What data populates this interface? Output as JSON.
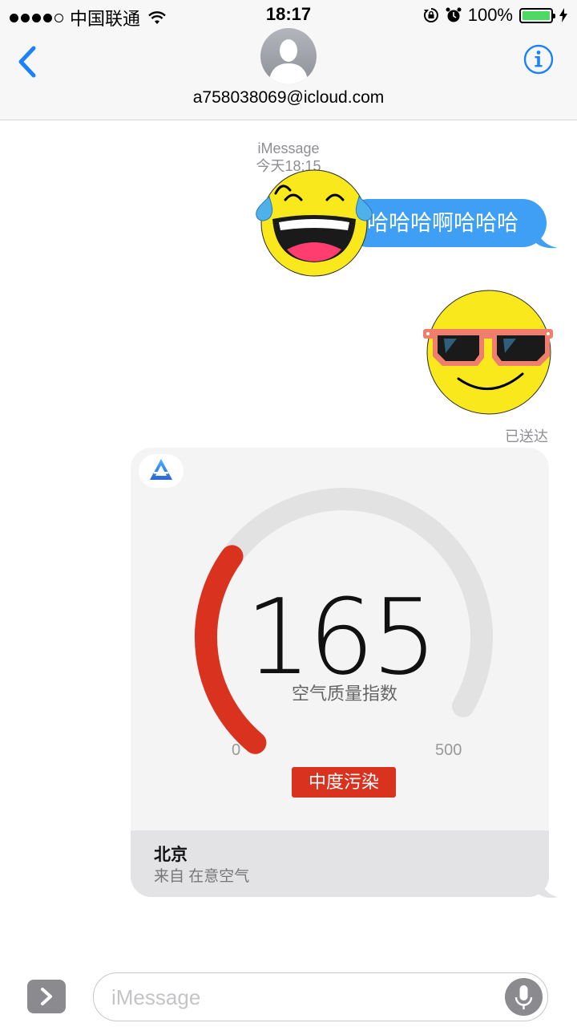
{
  "status_bar": {
    "carrier": "中国联通",
    "time": "18:17",
    "battery_percent": "100%",
    "battery_level": 1.0,
    "battery_color": "#4cd964",
    "icons": [
      "signal-dots-icon",
      "wifi-icon",
      "rotation-lock-icon",
      "alarm-icon",
      "battery-icon",
      "charging-bolt-icon"
    ]
  },
  "header": {
    "contact": "a758038069@icloud.com",
    "icons": [
      "back-chevron-icon",
      "avatar-silhouette-icon",
      "info-icon"
    ],
    "accent_color": "#1a82fb"
  },
  "conversation": {
    "service": "iMessage",
    "timestamp": "今天18:15",
    "messages": [
      {
        "type": "text",
        "text": "哈哈哈啊哈哈哈",
        "bubble_color": "#3f9ff5"
      },
      {
        "type": "sticker",
        "icon": "laughing-tears-emoji-icon"
      },
      {
        "type": "sticker",
        "icon": "sunglasses-emoji-icon"
      }
    ],
    "delivered": "已送达"
  },
  "air_card": {
    "app_icon": "zaiyi-kongqi-logo-icon",
    "aqi": "165",
    "aqi_label": "空气质量指数",
    "scale_min": "0",
    "scale_max": "500",
    "level": "中度污染",
    "level_color": "#d9321f",
    "gauge_fraction": 0.33,
    "gauge_color": "#d9321f",
    "gauge_track_color": "#e2e2e2",
    "city": "北京",
    "source": "来自 在意空气"
  },
  "input_bar": {
    "placeholder": "iMessage",
    "icons": [
      "expand-chevron-icon",
      "microphone-icon"
    ]
  }
}
